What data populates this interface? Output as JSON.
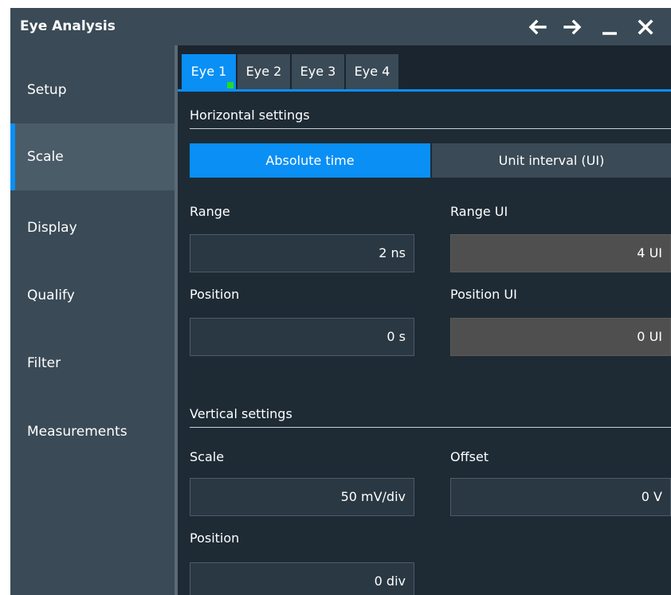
{
  "window": {
    "title": "Eye Analysis"
  },
  "titlebar": {
    "icons": [
      "arrow-left-icon",
      "arrow-right-icon",
      "minimize-icon",
      "close-icon"
    ]
  },
  "sidebar": {
    "items": [
      {
        "label": "Setup",
        "active": false
      },
      {
        "label": "Scale",
        "active": true
      },
      {
        "label": "Display",
        "active": false
      },
      {
        "label": "Qualify",
        "active": false
      },
      {
        "label": "Filter",
        "active": false
      },
      {
        "label": "Measurements",
        "active": false
      }
    ]
  },
  "tabs": [
    {
      "label": "Eye 1",
      "active": true
    },
    {
      "label": "Eye 2",
      "active": false
    },
    {
      "label": "Eye 3",
      "active": false
    },
    {
      "label": "Eye 4",
      "active": false
    }
  ],
  "horizontal": {
    "title": "Horizontal settings",
    "mode_options": [
      "Absolute time",
      "Unit interval (UI)"
    ],
    "mode_selected": "Absolute time",
    "range": {
      "label": "Range",
      "value": "2 ns"
    },
    "range_ui": {
      "label": "Range UI",
      "value": "4 UI"
    },
    "position": {
      "label": "Position",
      "value": "0 s"
    },
    "position_ui": {
      "label": "Position UI",
      "value": "0 UI"
    }
  },
  "vertical": {
    "title": "Vertical settings",
    "scale": {
      "label": "Scale",
      "value": "50 mV/div"
    },
    "offset": {
      "label": "Offset",
      "value": "0 V"
    },
    "position": {
      "label": "Position",
      "value": "0 div"
    }
  },
  "colors": {
    "accent": "#0a8ff5",
    "tab_indicator": "#22dd22",
    "panel": "#1e2b35",
    "sidebar": "#3a4a56"
  }
}
